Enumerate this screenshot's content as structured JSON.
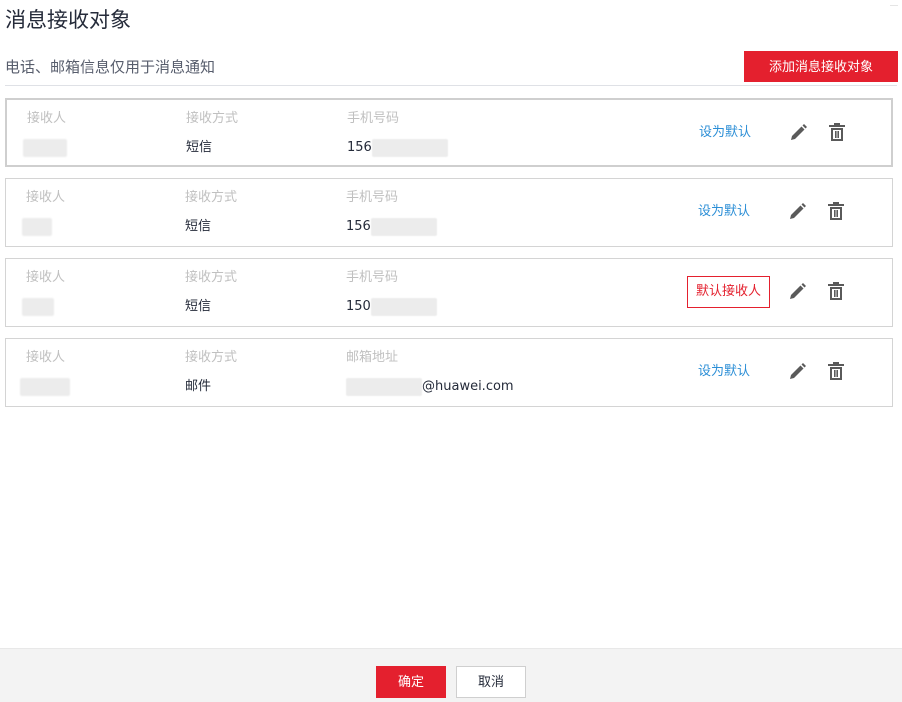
{
  "page": {
    "title": "消息接收对象",
    "subtitle": "电话、邮箱信息仅用于消息通知",
    "add_button_label": "添加消息接收对象"
  },
  "colors": {
    "accent": "#e4202e",
    "link": "#2b8ed6",
    "border": "#d4d4d4"
  },
  "columns": {
    "receiver": "接收人",
    "method": "接收方式",
    "phone": "手机号码",
    "email": "邮箱地址"
  },
  "recipients": [
    {
      "method": "短信",
      "contact_prefix": "156",
      "contact_suffix": "",
      "action": "设为默认",
      "is_default": false
    },
    {
      "method": "短信",
      "contact_prefix": "156",
      "contact_suffix": "",
      "action": "设为默认",
      "is_default": false
    },
    {
      "method": "短信",
      "contact_prefix": "150",
      "contact_suffix": "",
      "action": "默认接收人",
      "is_default": true
    },
    {
      "method": "邮件",
      "contact_prefix": "",
      "contact_suffix": "@huawei.com",
      "action": "设为默认",
      "is_default": false
    }
  ],
  "icons": {
    "edit": "pencil-icon",
    "delete": "trash-icon"
  },
  "footer": {
    "confirm_label": "确定",
    "cancel_label": "取消"
  }
}
